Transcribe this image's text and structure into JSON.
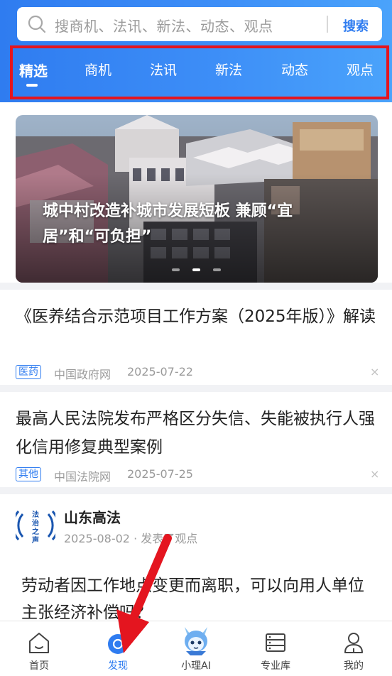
{
  "search": {
    "placeholder": "搜商机、法讯、新法、动态、观点",
    "button": "搜索"
  },
  "tabs": [
    {
      "label": "精选",
      "active": true
    },
    {
      "label": "商机"
    },
    {
      "label": "法讯"
    },
    {
      "label": "新法"
    },
    {
      "label": "动态"
    },
    {
      "label": "观点"
    }
  ],
  "banner": {
    "title": "城中村改造补城市发展短板 兼顾“宜居”和“可负担”",
    "slide_count": 3,
    "active_slide": 2
  },
  "articles": [
    {
      "title": "《医养结合示范项目工作方案（2025年版）》解读",
      "tag": "医药",
      "source": "中国政府网",
      "date": "2025-07-22",
      "close": "×"
    },
    {
      "title": "最高人民法院发布严格区分失信、失能被执行人强化信用修复典型案例",
      "tag": "其他",
      "source": "中国法院网",
      "date": "2025-07-25",
      "close": "×"
    }
  ],
  "post": {
    "author": "山东高法",
    "avatar_text": "法治之声",
    "meta": "2025-08-02 · 发表了观点",
    "text": "劳动者因工作地点变更而离职，可以向用人单位主张经济补偿吗？"
  },
  "bottom_nav": [
    {
      "label": "首页",
      "icon": "home-icon"
    },
    {
      "label": "发现",
      "icon": "discover-icon",
      "active": true
    },
    {
      "label": "小理AI",
      "icon": "ai-mascot-icon"
    },
    {
      "label": "专业库",
      "icon": "library-icon"
    },
    {
      "label": "我的",
      "icon": "profile-icon"
    }
  ],
  "colors": {
    "accent": "#2f7cf0",
    "highlight_frame": "#e4151f",
    "arrow": "#e4151f"
  }
}
